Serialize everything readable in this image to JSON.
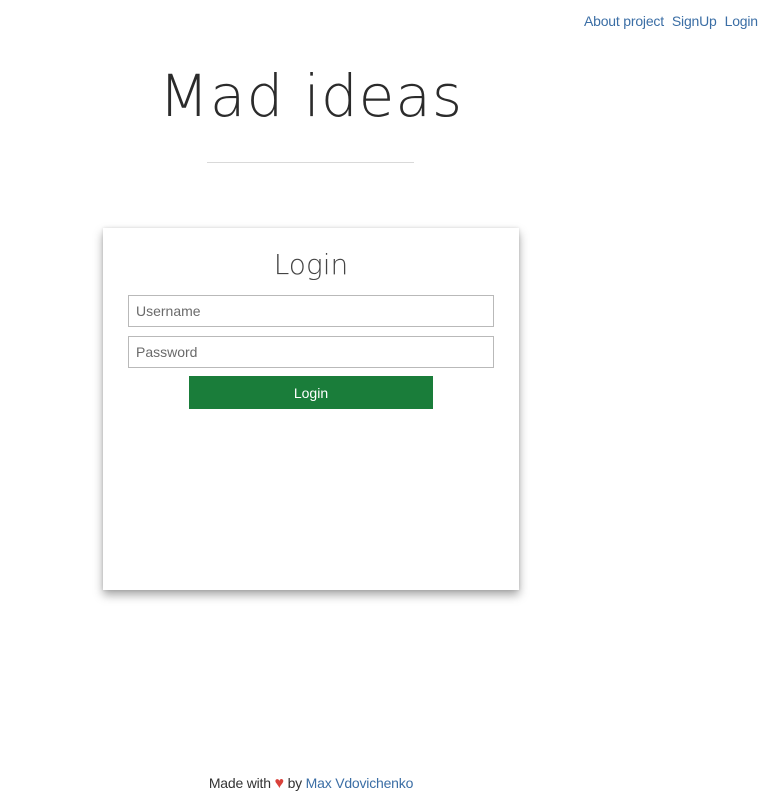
{
  "nav": {
    "about_label": "About project",
    "signup_label": "SignUp",
    "login_label": "Login"
  },
  "header": {
    "title": "Mad ideas"
  },
  "login_form": {
    "title": "Login",
    "username_placeholder": "Username",
    "password_placeholder": "Password",
    "submit_label": "Login"
  },
  "footer": {
    "made_with": "Made with",
    "heart_icon": "heart-icon",
    "heart_glyph": "♥",
    "by": "by",
    "author": "Max Vdovichenko"
  },
  "colors": {
    "link": "#3b6ea5",
    "button": "#1a7d3a",
    "heart": "#d9413a"
  }
}
